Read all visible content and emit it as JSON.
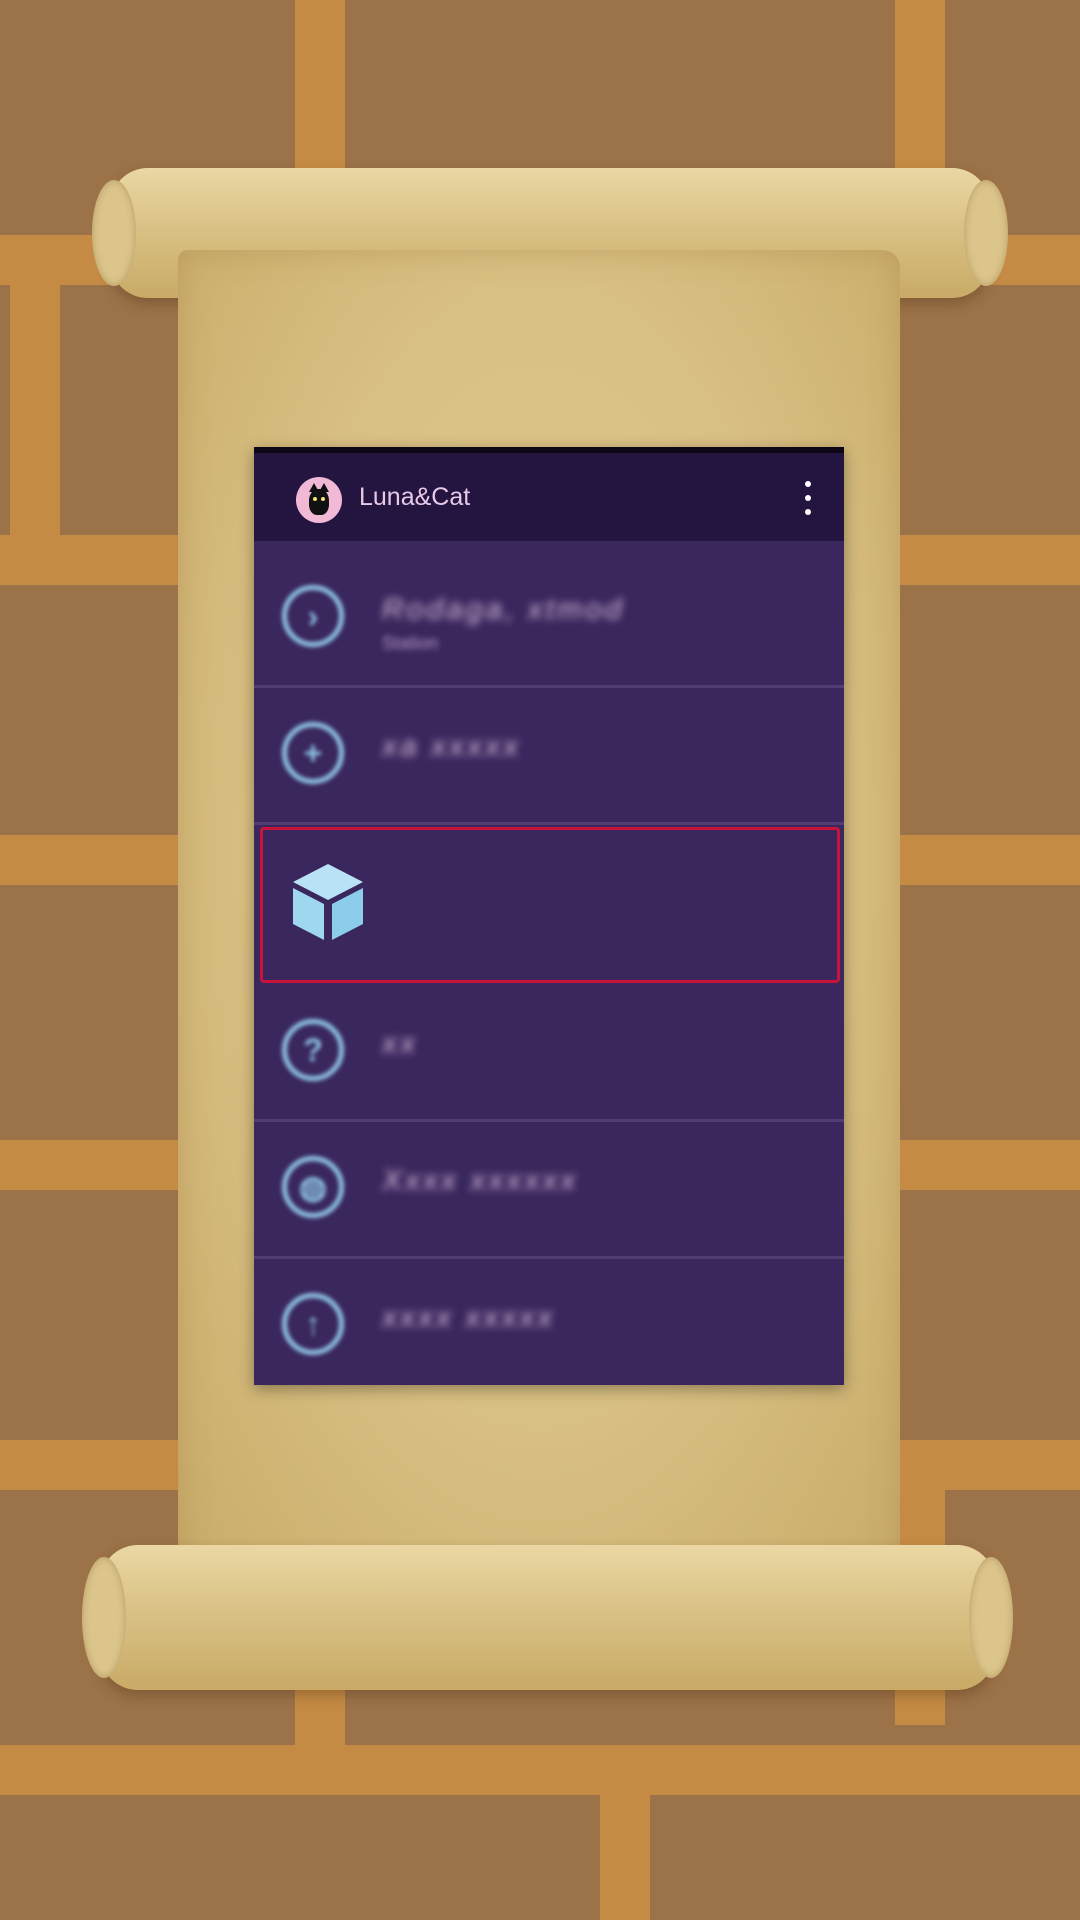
{
  "app": {
    "title": "Luna&Cat"
  },
  "toolbar": {
    "avatar_icon": "black-cat-avatar-icon",
    "overflow_icon": "more-vertical-icon"
  },
  "menu": {
    "items": [
      {
        "icon": "chevron-right-circle-icon",
        "label": "Rodaga, xtmod",
        "sublabel": "Station"
      },
      {
        "icon": "plus-circle-icon",
        "label": "xa xxxxx",
        "sublabel": ""
      },
      {
        "icon": "cube-icon",
        "label": "",
        "sublabel": "",
        "selected": true
      },
      {
        "icon": "question-circle-icon",
        "label": "xx",
        "sublabel": ""
      },
      {
        "icon": "globe-icon",
        "label": "Xxxx xxxxxx",
        "sublabel": ""
      },
      {
        "icon": "upload-circle-icon",
        "label": "xxxx xxxxx",
        "sublabel": ""
      }
    ]
  },
  "colors": {
    "app_bar": "#231540",
    "list_bg": "#3a275d",
    "icon": "#8fc6e6",
    "highlight": "#c8143c"
  }
}
